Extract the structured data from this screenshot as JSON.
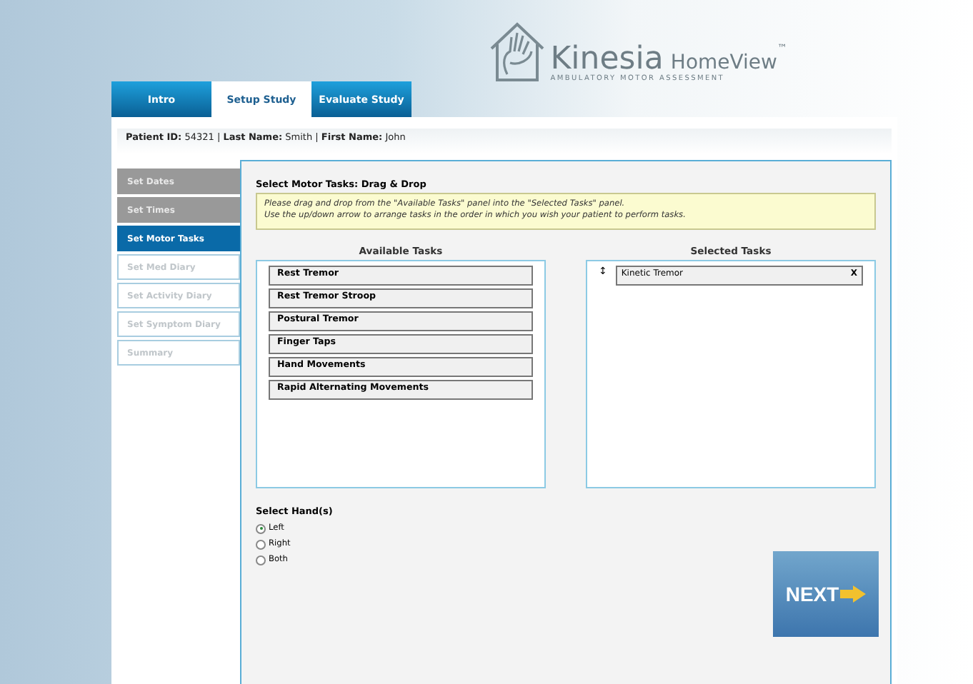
{
  "logo": {
    "name": "Kinesia",
    "product": "HomeView",
    "trademark": "™",
    "tagline": "AMBULATORY MOTOR ASSESSMENT"
  },
  "tabs": [
    {
      "label": "Intro",
      "selected": false
    },
    {
      "label": "Setup Study",
      "selected": true
    },
    {
      "label": "Evaluate Study",
      "selected": false
    }
  ],
  "patient_info": "**Patient ID:** 54321 | **Last Name:** Smith | **First Name:** John",
  "sidebar": {
    "items": [
      {
        "label": "Set Dates",
        "completed": true,
        "selected": false
      },
      {
        "label": "Set Times",
        "completed": true,
        "selected": false
      },
      {
        "label": "Set Motor Tasks",
        "completed": false,
        "selected": true
      },
      {
        "label": "Set Med Diary",
        "completed": false,
        "selected": false
      },
      {
        "label": "Set Activity Diary",
        "completed": false,
        "selected": false
      },
      {
        "label": "Set Symptom Diary",
        "completed": false,
        "selected": false
      },
      {
        "label": "Summary",
        "completed": false,
        "selected": false
      }
    ]
  },
  "section_title": "Select Motor Tasks: Drag & Drop",
  "instructions": [
    "Please drag and drop from the \"Available Tasks\" panel into the \"Selected Tasks\" panel.",
    "Use the up/down arrow to arrange tasks in the order in which you wish your patient to perform tasks."
  ],
  "available_tasks": {
    "title": "Available Tasks",
    "items": [
      "Rest Tremor",
      "Rest Tremor Stroop",
      "Postural Tremor",
      "Finger Taps",
      "Hand Movements",
      "Rapid Alternating Movements"
    ]
  },
  "selected_tasks": {
    "title": "Selected Tasks",
    "items": [
      {
        "arrow": "↕",
        "label": "Kinetic Tremor",
        "remove": "X"
      }
    ]
  },
  "hands": {
    "title": "Select Hand(s)",
    "options": [
      {
        "label": "Left",
        "selected": true
      },
      {
        "label": "Right",
        "selected": false
      },
      {
        "label": "Both",
        "selected": false
      }
    ]
  },
  "next_button": "NEXT"
}
